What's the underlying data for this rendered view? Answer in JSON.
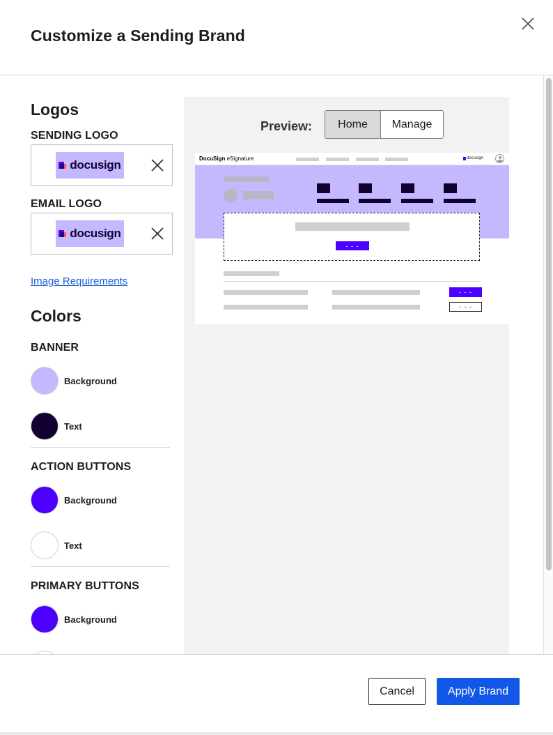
{
  "header": {
    "title": "Customize a Sending Brand"
  },
  "logos": {
    "heading": "Logos",
    "sending_logo": {
      "label": "SENDING LOGO",
      "logo_text": "docusign"
    },
    "email_logo": {
      "label": "EMAIL LOGO",
      "logo_text": "docusign"
    },
    "image_requirements_link": "Image Requirements"
  },
  "colors": {
    "heading": "Colors",
    "groups": [
      {
        "label": "BANNER",
        "swatches": [
          {
            "label": "Background",
            "color": "#c4b8ff"
          },
          {
            "label": "Text",
            "color": "#130032"
          }
        ]
      },
      {
        "label": "ACTION BUTTONS",
        "swatches": [
          {
            "label": "Background",
            "color": "#4c00ff"
          },
          {
            "label": "Text",
            "color": "#ffffff"
          }
        ]
      },
      {
        "label": "PRIMARY BUTTONS",
        "swatches": [
          {
            "label": "Background",
            "color": "#4c00ff"
          }
        ]
      }
    ]
  },
  "preview": {
    "label": "Preview:",
    "tabs": [
      {
        "label": "Home",
        "active": true
      },
      {
        "label": "Manage",
        "active": false
      }
    ],
    "mock": {
      "brand_name": "DocuSign",
      "product_name": "eSignature",
      "mini_logo_text": "docusign",
      "card_button": "- - -",
      "row_button_primary": "- - -",
      "row_button_secondary": "- - -"
    }
  },
  "footer": {
    "cancel_label": "Cancel",
    "apply_label": "Apply Brand"
  },
  "theme": {
    "accent": "#1258e6",
    "brand_purple": "#4c00ff",
    "banner_lavender": "#c4b8ff",
    "brand_dark": "#130032"
  }
}
